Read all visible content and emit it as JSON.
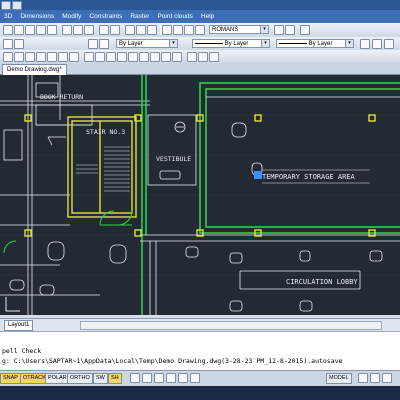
{
  "menu": {
    "items": [
      "3D",
      "Dimensions",
      "Modify",
      "Constraints",
      "Raster",
      "Point clouds",
      "Help"
    ]
  },
  "toolbar": {
    "style_combo": "ROMANS",
    "layer_combo": "By Layer",
    "linetype_combo": "By Layer",
    "lineweight_combo": "By Layer"
  },
  "document": {
    "tab_label": "Demo Drawing.dwg*"
  },
  "drawing": {
    "labels": {
      "book_return": "BOOK RETURN",
      "stair": "STAIR NO.3",
      "vestibule": "VESTIBULE",
      "center_text": "TEMPORARY STORAGE AREA",
      "circulation": "CIRCULATION LOBBY"
    }
  },
  "layout_tab": "Layout1",
  "command": {
    "line1": "pell Check",
    "line2": "g: C:\\Users\\SAPTAR~1\\AppData\\Local\\Temp\\Demo Drawing.dwg(3-28-23 PM_12-8-2015).autosave"
  },
  "status": {
    "buttons": [
      {
        "label": "SNAP",
        "on": true
      },
      {
        "label": "OTRACK",
        "on": true
      },
      {
        "label": "POLAR",
        "on": false
      },
      {
        "label": "ORTHO",
        "on": false
      },
      {
        "label": "SW",
        "on": false
      },
      {
        "label": "SH",
        "on": true
      }
    ],
    "model_label": "MODEL"
  },
  "colors": {
    "canvas_bg": "#242a34",
    "wall_green": "#2fd04a",
    "wall_yellow": "#e2e23a",
    "line_white": "#e8ecf0"
  }
}
